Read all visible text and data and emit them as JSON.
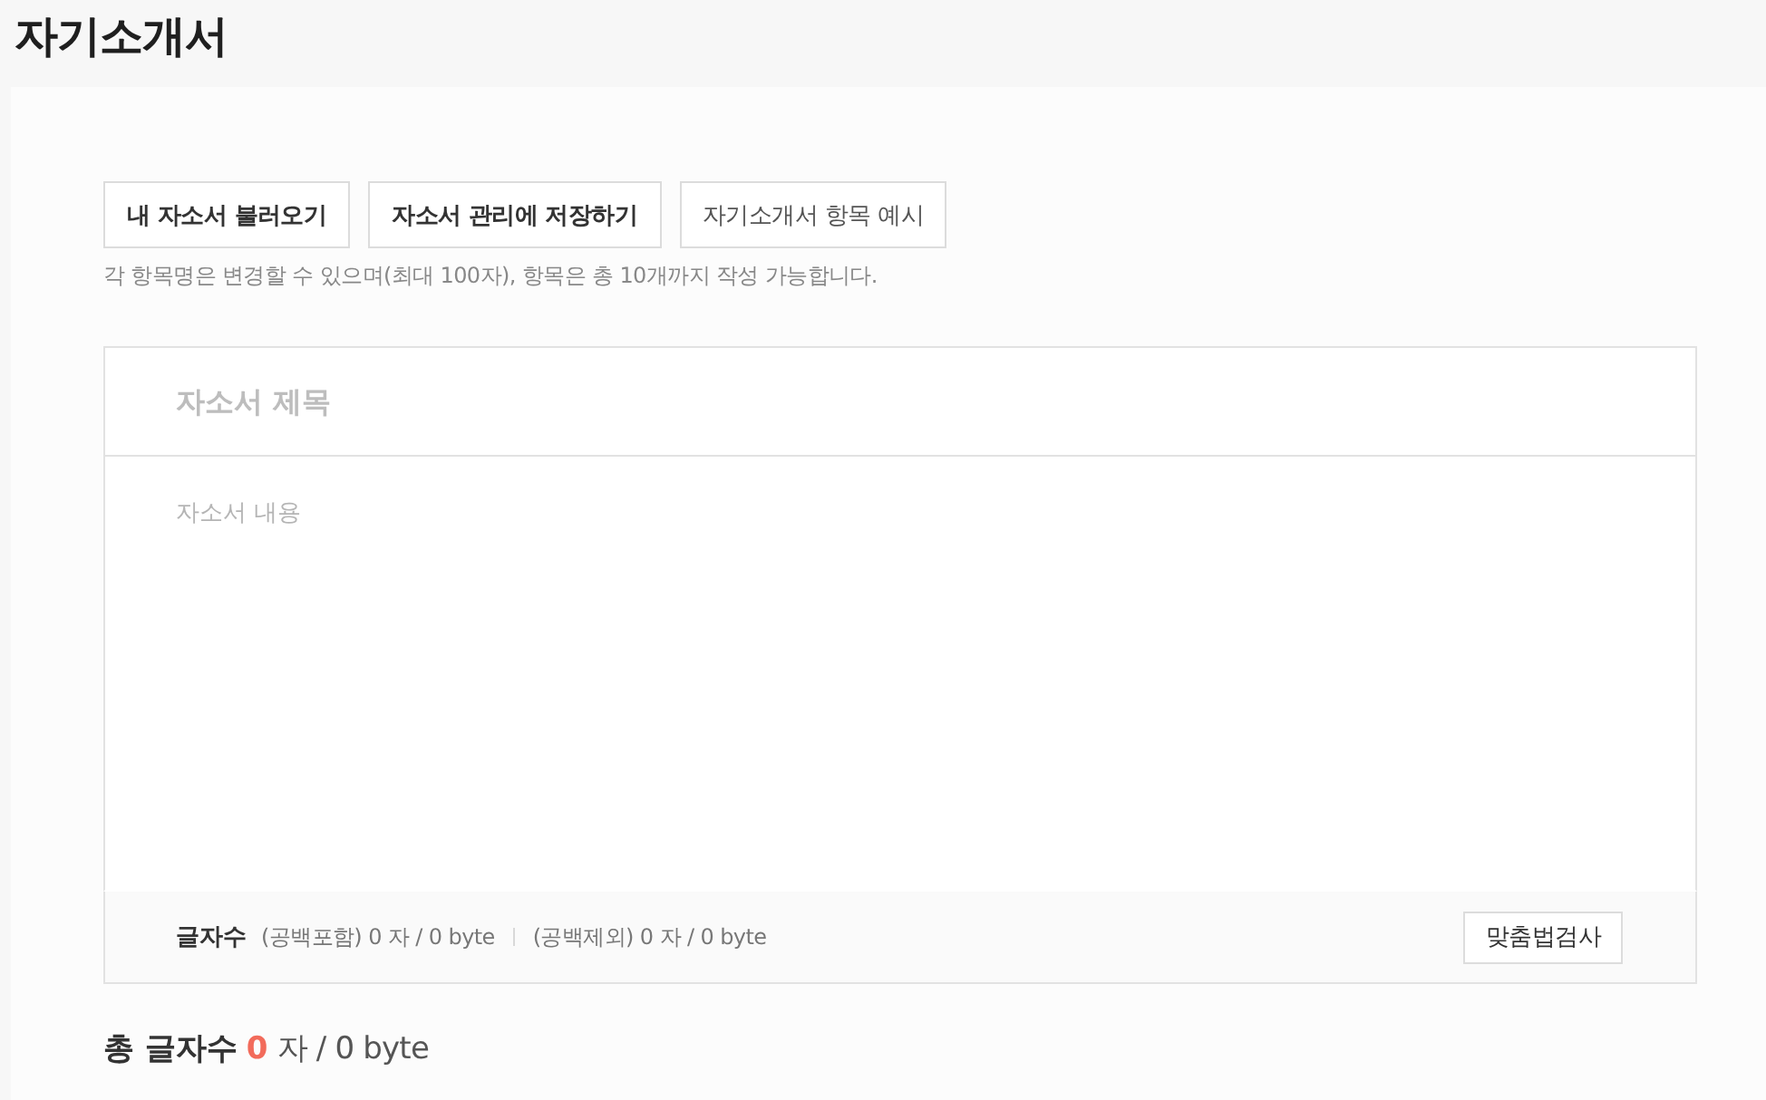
{
  "page_title": "자기소개서",
  "toolbar": {
    "buttons": [
      {
        "label": "내 자소서 불러오기",
        "bold": true
      },
      {
        "label": "자소서 관리에 저장하기",
        "bold": true
      },
      {
        "label": "자기소개서 항목 예시",
        "bold": false
      }
    ],
    "hint": "각 항목명은 변경할 수 있으며(최대 100자), 항목은 총 10개까지 작성 가능합니다."
  },
  "editor": {
    "title_field": {
      "placeholder": "자소서 제목"
    },
    "body_field": {
      "placeholder": "자소서 내용"
    },
    "counter": {
      "label": "글자수",
      "with_spaces": "(공백포함) 0 자 / 0 byte",
      "without_spaces": "(공백제외) 0 자 / 0 byte"
    },
    "spell_check_button": "맞춤법검사"
  },
  "total": {
    "label": "총 글자수",
    "char_count": "0",
    "rest": "자 / 0 byte"
  }
}
